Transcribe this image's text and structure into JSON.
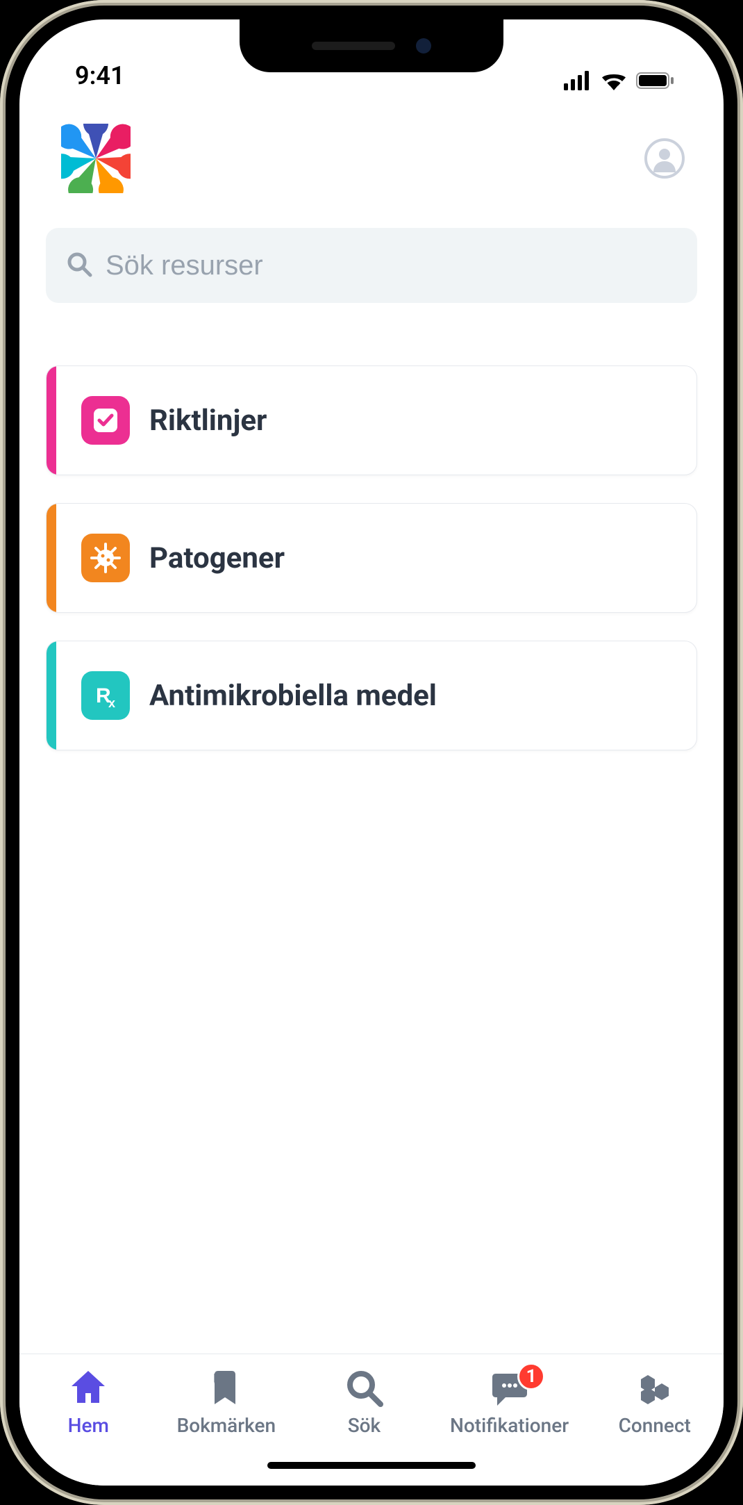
{
  "status": {
    "time": "9:41"
  },
  "search": {
    "placeholder": "Sök resurser"
  },
  "categories": [
    {
      "label": "Riktlinjer",
      "accent": "#ec2f92",
      "icon": "checkbox"
    },
    {
      "label": "Patogener",
      "accent": "#f2861f",
      "icon": "virus"
    },
    {
      "label": "Antimikrobiella medel",
      "accent": "#22c6c0",
      "icon": "rx"
    }
  ],
  "tabs": {
    "home": "Hem",
    "bookmarks": "Bokmärken",
    "search": "Sök",
    "notifications": "Notifikationer",
    "notifications_badge": "1",
    "connect": "Connect"
  }
}
